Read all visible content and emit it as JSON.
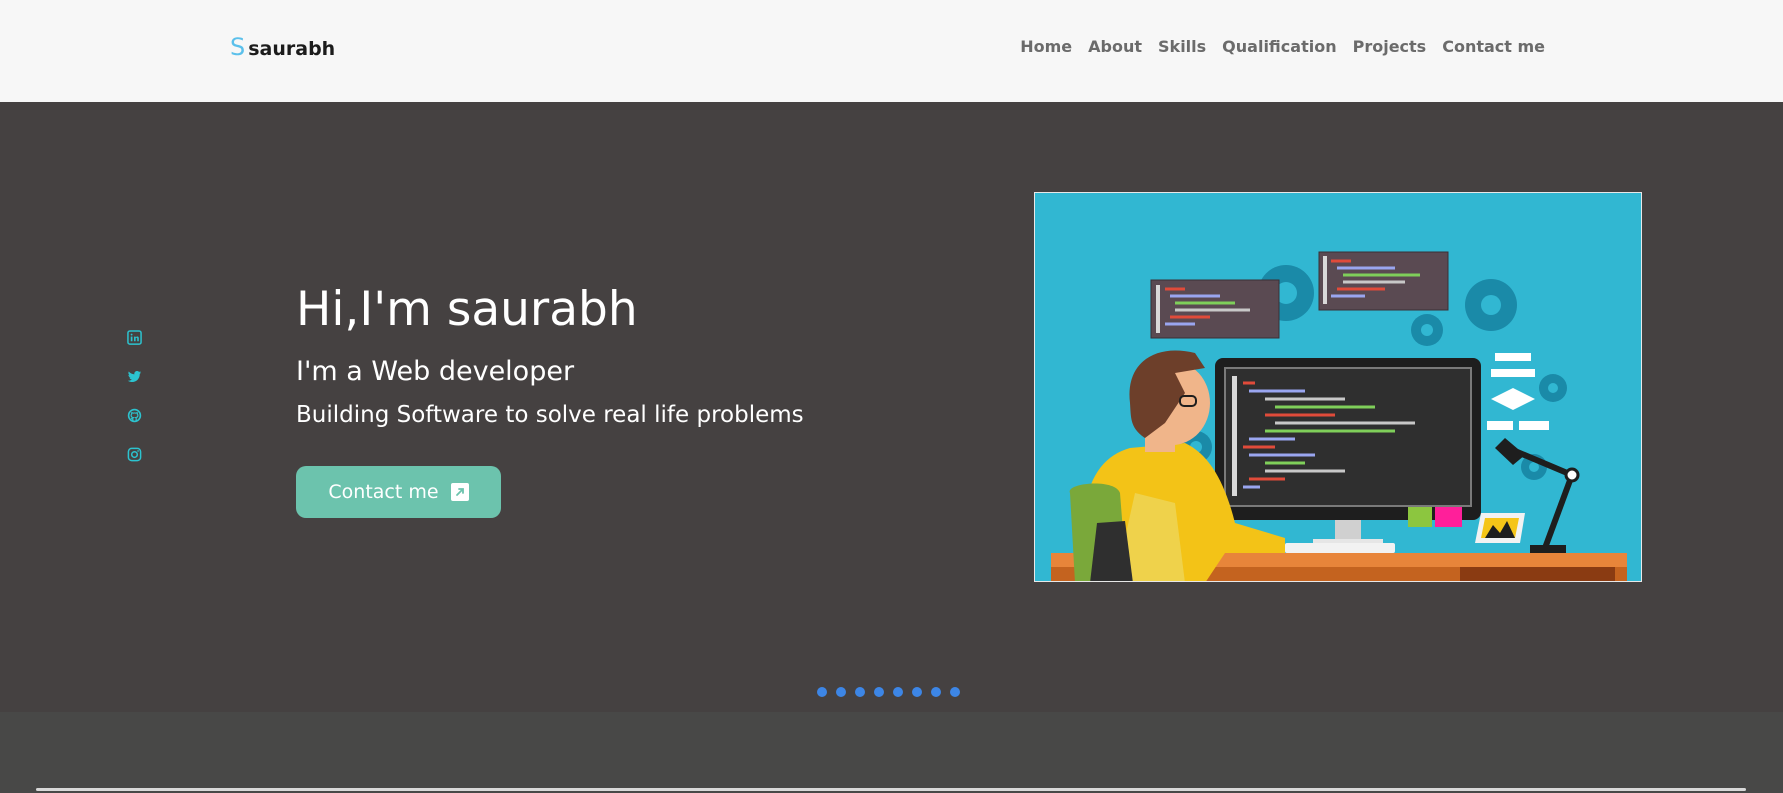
{
  "brand": {
    "mark": "S",
    "name": "saurabh"
  },
  "nav": {
    "items": [
      "Home",
      "About",
      "Skills",
      "Qualification",
      "Projects",
      "Contact me"
    ]
  },
  "social": {
    "icons": [
      "linkedin-icon",
      "twitter-icon",
      "github-icon",
      "instagram-icon"
    ],
    "color": "#2cc3cf"
  },
  "hero": {
    "title": "Hi,I'm saurabh",
    "role": "I'm a Web developer",
    "tagline": "Building Software to solve real life problems",
    "cta_label": "Contact me",
    "cta_icon": "external-link-icon",
    "image": "developer-at-computer-illustration"
  },
  "carousel": {
    "dot_count": 8
  },
  "colors": {
    "accent": "#6cc3ad",
    "logo": "#5bc0eb",
    "hero_bg": "#454141",
    "dot": "#3d86e6"
  }
}
